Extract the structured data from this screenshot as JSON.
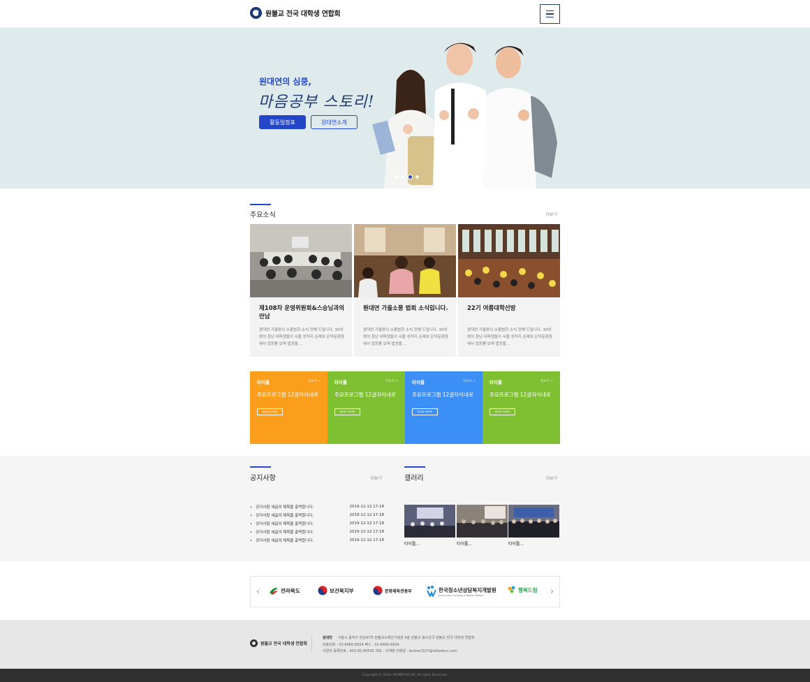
{
  "header": {
    "logo_text": "원불교 전국 대학생 연합회"
  },
  "hero": {
    "subtitle": "원대연의 심쿵,",
    "title": "마음공부 스토리!",
    "buttons": [
      {
        "label": "활동일정표"
      },
      {
        "label": "원대연소개"
      }
    ],
    "slide_count": 4,
    "active_slide": 3
  },
  "news": {
    "title": "주요소식",
    "more": "더보기",
    "cards": [
      {
        "title": "제108차 운영위원회&스승님과의 만남",
        "desc": "원대연 가을맞이 소풍법회 소식 전해 드립니다. 30여명의 청년 대학생들이 서울 성적지 순례와 은덕문화원에서 법회를 보며 법정을..."
      },
      {
        "title": "원대연 가을소풍 법회 소식입니다.",
        "desc": "원대연 가을맞이 소풍법회 소식 전해 드립니다. 30여명의 청년 대학생들이 서울 성적지 순례와 은덕문화원에서 법회를 보며 법정을..."
      },
      {
        "title": "22기 여름대학선방",
        "desc": "원대연 가을맞이 소풍법회 소식 전해 드립니다. 30여명의 청년 대학생들이 서울 성적지 순례와 은덕문화원에서 법회를 보며 법정을..."
      }
    ]
  },
  "programs": {
    "tiles": [
      {
        "label": "타이틀",
        "more": "더보기 +",
        "text": "주요프로그램 12글자이내로",
        "btn": "READ MORE",
        "color": "#fb9e1b"
      },
      {
        "label": "타이틀",
        "more": "더보기 +",
        "text": "주요프로그램 12글자이내로",
        "btn": "READ MORE",
        "color": "#7fc033"
      },
      {
        "label": "타이틀",
        "more": "더보기 +",
        "text": "주요프로그램 12글자이내로",
        "btn": "READ MORE",
        "color": "#3b8ff5"
      },
      {
        "label": "타이틀",
        "more": "더보기 +",
        "text": "주요프로그램 12글자이내로",
        "btn": "READ MORE",
        "color": "#7fc033"
      }
    ]
  },
  "notice": {
    "title": "공지사항",
    "more": "더보기",
    "items": [
      {
        "text": "공지사항 세글의 제목을 출력합니다.",
        "date": "2019-12-12 17:18"
      },
      {
        "text": "공지사항 세글의 제목을 출력합니다.",
        "date": "2019-12-12 17:18"
      },
      {
        "text": "공지사항 세글의 제목을 출력합니다.",
        "date": "2019-12-12 17:18"
      },
      {
        "text": "공지사항 세글의 제목을 출력합니다.",
        "date": "2019-12-12 17:18"
      },
      {
        "text": "공지사항 세글의 제목을 출력합니다.",
        "date": "2019-12-12 17:18"
      }
    ]
  },
  "gallery": {
    "title": "갤러리",
    "more": "더보기",
    "items": [
      {
        "caption": "타이틀..."
      },
      {
        "caption": "타이틀..."
      },
      {
        "caption": "타이틀..."
      }
    ]
  },
  "partners": [
    {
      "name": "전라북도"
    },
    {
      "name": "보건복지부"
    },
    {
      "name": "문화체육관광부"
    },
    {
      "name": "한국청소년상담복지개발원",
      "sub": "Korea Youth Counseling & Welfare Institute"
    },
    {
      "name": "행복드림"
    }
  ],
  "footer": {
    "logo_text": "원불교 전국 대학생 연합회",
    "org": "원대연",
    "address": "서울시 동작구 한강로75 원불교소태산기념관 9층 원불교 청소년국 원불교 전국 대학생 연합회",
    "contact": "대표전화 : 02-6960-8924  팩스 : 02-6960-8934",
    "biz": "사업자 등록번호 : 402-81-80591   대표 : 이재영   이메일 : buster2107@lottedacc.com",
    "copyright": "Copyright © 2018. WONDY.OR.KR. All rights Reserved."
  }
}
